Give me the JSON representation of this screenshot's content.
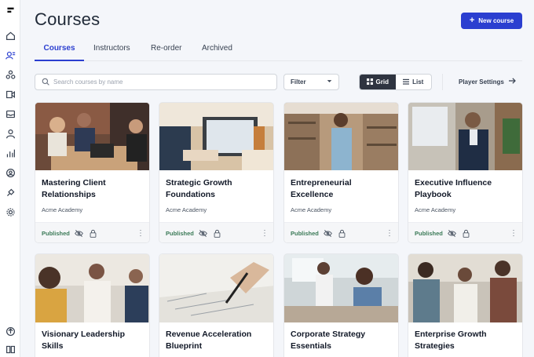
{
  "app": {
    "page_title": "Courses",
    "new_course_label": "New course"
  },
  "tabs": [
    {
      "label": "Courses",
      "active": true
    },
    {
      "label": "Instructors",
      "active": false
    },
    {
      "label": "Re-order",
      "active": false
    },
    {
      "label": "Archived",
      "active": false
    }
  ],
  "toolbar": {
    "search_placeholder": "Search courses by name",
    "filter_label": "Filter",
    "grid_label": "Grid",
    "list_label": "List",
    "selected_view": "Grid",
    "player_settings_label": "Player Settings"
  },
  "sidebar": {
    "icons": [
      "logo-icon",
      "home-icon",
      "courses-icon",
      "community-icon",
      "video-icon",
      "inbox-icon",
      "user-icon",
      "analytics-icon",
      "account-icon",
      "integrations-icon",
      "settings-icon",
      "upload-icon",
      "book-icon"
    ]
  },
  "cards": [
    {
      "title": "Mastering Client Relationships",
      "academy": "Acme Academy",
      "status": "Published"
    },
    {
      "title": "Strategic Growth Foundations",
      "academy": "Acme Academy",
      "status": "Published"
    },
    {
      "title": "Entrepreneurial Excellence",
      "academy": "Acme Academy",
      "status": "Published"
    },
    {
      "title": "Executive Influence Playbook",
      "academy": "Acme Academy",
      "status": "Published"
    },
    {
      "title": "Visionary Leadership Skills"
    },
    {
      "title": "Revenue Acceleration Blueprint"
    },
    {
      "title": "Corporate Strategy Essentials"
    },
    {
      "title": "Enterprise Growth Strategies"
    }
  ],
  "colors": {
    "accent": "#2b3fd0",
    "published": "#3b7a57",
    "active_toggle": "#2f3440"
  }
}
